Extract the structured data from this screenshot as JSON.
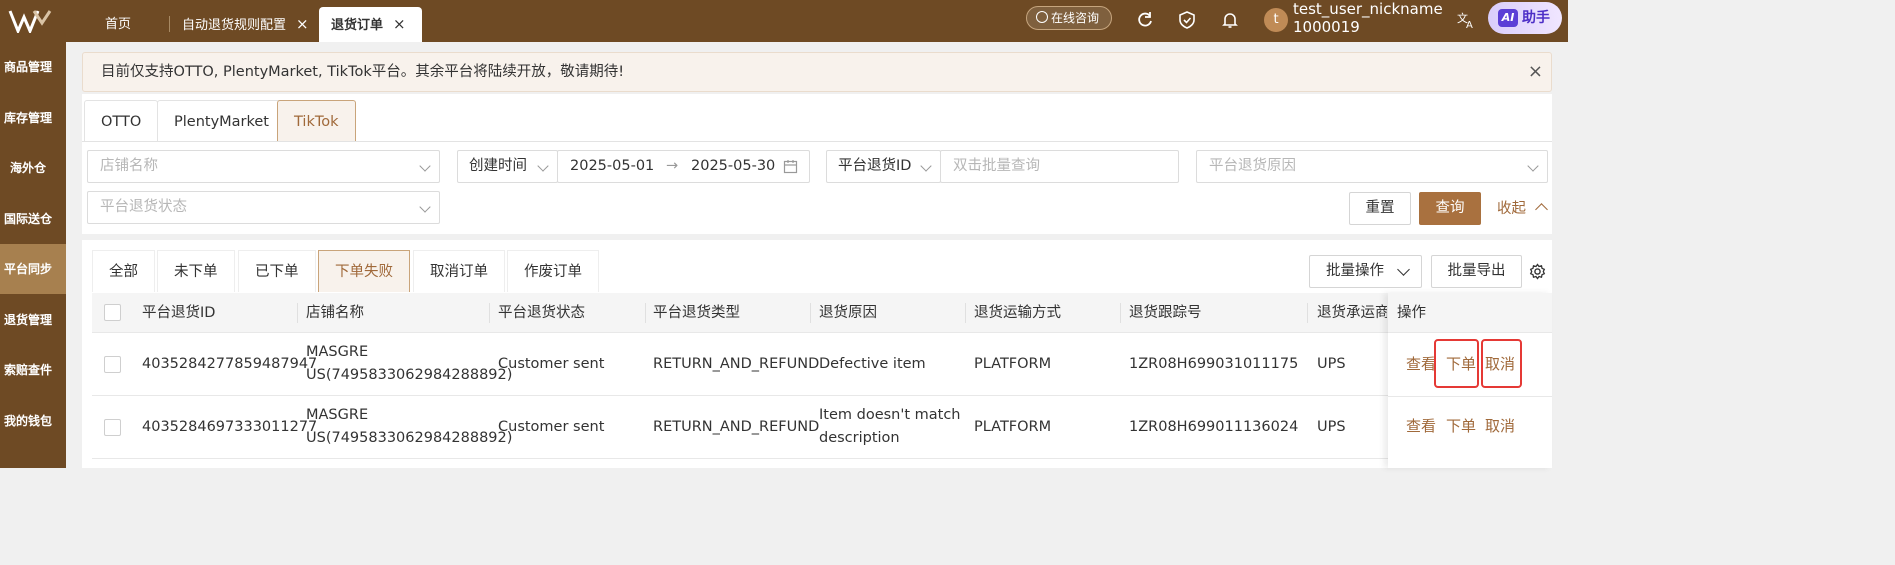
{
  "header": {
    "tabs": [
      {
        "label": "首页"
      },
      {
        "label": "自动退货规则配置"
      },
      {
        "label": "退货订单"
      }
    ],
    "consult_label": "在线咨询",
    "user": {
      "initial": "t",
      "nickname": "test_user_nickname",
      "id": "1000019"
    },
    "ai_badge": "AI",
    "ai_label": "助手"
  },
  "sidebar": {
    "items": [
      {
        "label": "商品管理"
      },
      {
        "label": "库存管理"
      },
      {
        "label": "海外仓"
      },
      {
        "label": "国际送仓"
      },
      {
        "label": "平台同步"
      },
      {
        "label": "退货管理"
      },
      {
        "label": "索赔查件"
      },
      {
        "label": "我的钱包"
      }
    ]
  },
  "notice": {
    "text": "目前仅支持OTTO, PlentyMarket, TikTok平台。其余平台将陆续开放，敬请期待!"
  },
  "platform_tabs": [
    {
      "label": "OTTO"
    },
    {
      "label": "PlentyMarket"
    },
    {
      "label": "TikTok"
    }
  ],
  "filters": {
    "store_placeholder": "店铺名称",
    "time_type": "创建时间",
    "date_start": "2025-05-01",
    "date_arrow": "→",
    "date_end": "2025-05-30",
    "id_type": "平台退货ID",
    "id_placeholder": "双击批量查询",
    "reason_placeholder": "平台退货原因",
    "status_placeholder": "平台退货状态",
    "reset_label": "重置",
    "search_label": "查询",
    "collapse_label": "收起"
  },
  "status_tabs": [
    {
      "label": "全部"
    },
    {
      "label": "未下单"
    },
    {
      "label": "已下单"
    },
    {
      "label": "下单失败"
    },
    {
      "label": "取消订单"
    },
    {
      "label": "作废订单"
    }
  ],
  "toolbar": {
    "batch_ops_label": "批量操作",
    "batch_export_label": "批量导出"
  },
  "table": {
    "columns": [
      "平台退货ID",
      "店铺名称",
      "平台退货状态",
      "平台退货类型",
      "退货原因",
      "退货运输方式",
      "退货跟踪号",
      "退货承运商",
      "操作"
    ],
    "rows": [
      {
        "id": "4035284277859487947",
        "store_line1": "MASGRE",
        "store_line2": "US(7495833062984288892)",
        "status": "Customer sent",
        "type": "RETURN_AND_REFUND",
        "reason_line1": "Defective item",
        "reason_line2": "",
        "shipping": "PLATFORM",
        "tracking": "1ZR08H699031011175",
        "carrier": "UPS",
        "ops": [
          "查看",
          "下单",
          "取消"
        ]
      },
      {
        "id": "4035284697333011277",
        "store_line1": "MASGRE",
        "store_line2": "US(7495833062984288892)",
        "status": "Customer sent",
        "type": "RETURN_AND_REFUND",
        "reason_line1": "Item doesn't match",
        "reason_line2": "description",
        "shipping": "PLATFORM",
        "tracking": "1ZR08H699011136024",
        "carrier": "UPS",
        "ops": [
          "查看",
          "下单",
          "取消"
        ]
      }
    ]
  },
  "colors": {
    "brand": "#6e4a24",
    "accent": "#a9713f",
    "highlight": "#e53935"
  }
}
